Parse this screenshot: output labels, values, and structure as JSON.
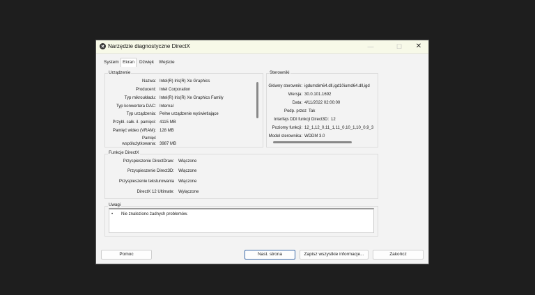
{
  "window": {
    "title": "Narzędzie diagnostyczne DirectX",
    "minimize_glyph": "—",
    "maximize_glyph": "☐",
    "close_glyph": "✕"
  },
  "tabs": [
    {
      "label": "System"
    },
    {
      "label": "Ekran"
    },
    {
      "label": "Dźwięk"
    },
    {
      "label": "Wejście"
    }
  ],
  "device": {
    "heading": "Urządzenie",
    "rows": [
      {
        "label": "Nazwa:",
        "value": "Intel(R) Iris(R) Xe Graphics"
      },
      {
        "label": "Producent:",
        "value": "Intel Corporation"
      },
      {
        "label": "Typ mikroukładu:",
        "value": "Intel(R) Iris(R) Xe Graphics Family"
      },
      {
        "label": "Typ konwertera DAC:",
        "value": "Internal"
      },
      {
        "label": "Typ urządzenia:",
        "value": "Pełne urządzenie wyświetlające"
      },
      {
        "label": "Przybl. całk. il. pamięci:",
        "value": "4115 MB"
      },
      {
        "label": "Pamięć wideo (VRAM):",
        "value": "128 MB"
      }
    ],
    "shared_label_1": "Pamięć",
    "shared_label_2": "współużytkowana:",
    "shared_value": "3987 MB"
  },
  "drivers": {
    "heading": "Sterowniki",
    "rows": [
      {
        "label": "Główny sterownik:",
        "value": "igdumdim64.dll,igd10iumd64.dll,igd"
      },
      {
        "label": "Wersja:",
        "value": "30.0.101.1692"
      },
      {
        "label": "Data:",
        "value": "4/11/2022 02:00:00"
      },
      {
        "label": "Podp. przez",
        "value": "Tak"
      },
      {
        "label": "Interfejs DDI funkcji Direct3D:",
        "value": "12"
      },
      {
        "label": "Poziomy funkcji:",
        "value": "12_1,12_0,11_1,11_0,10_1,10_0,9_3"
      },
      {
        "label": "Model sterownika:",
        "value": "WDDM 3.0"
      }
    ]
  },
  "directx_features": {
    "heading": "Funkcje DirectX",
    "rows": [
      {
        "label": "Przyspieszenie DirectDraw:",
        "value": "Włączone"
      },
      {
        "label": "Przyspieszenie Direct3D:",
        "value": "Włączone"
      },
      {
        "label": "Przyspieszenie teksturowania",
        "value": "Włączone"
      },
      {
        "label": "DirectX 12 Ultimate:",
        "value": "Wyłączone"
      }
    ]
  },
  "notes": {
    "heading": "Uwagi",
    "bullet": "•",
    "text": "Nie znaleziono żadnych problemów."
  },
  "buttons": {
    "help": "Pomoc",
    "next": "Nast. strona",
    "save": "Zapisz wszystkie informacje...",
    "exit": "Zakończ"
  }
}
